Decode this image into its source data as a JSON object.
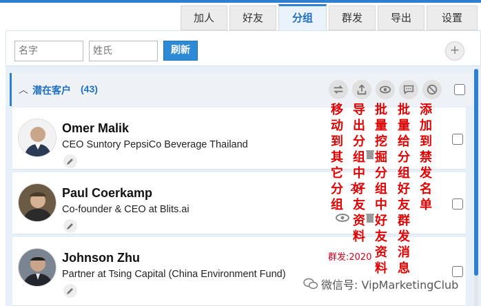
{
  "tabs": [
    {
      "label": "加人"
    },
    {
      "label": "好友"
    },
    {
      "label": "分组",
      "active": true
    },
    {
      "label": "群发"
    },
    {
      "label": "导出"
    },
    {
      "label": "设置"
    }
  ],
  "search": {
    "first_name_placeholder": "名字",
    "last_name_placeholder": "姓氏",
    "refresh_label": "刷新",
    "add_label": "+"
  },
  "group": {
    "name": "潜在客户",
    "count": "(43)",
    "actions": [
      "move-icon",
      "export-icon",
      "view-icon",
      "message-icon",
      "block-icon"
    ]
  },
  "contacts": [
    {
      "name": "Omer Malik",
      "title": "CEO Suntory PepsiCo Beverage Thailand"
    },
    {
      "name": "Paul Coerkamp",
      "title": "Co-founder & CEO at Blits.ai"
    },
    {
      "name": "Johnson Zhu",
      "title": "Partner at Tsing Capital (China Environment Fund)"
    }
  ],
  "send_status": {
    "row2": "20",
    "row3": "群发:2020"
  },
  "annotations": {
    "move": "移动到其它分组",
    "export": "导出分组中好友资料",
    "mine": "批量挖掘分组中好友资料",
    "message": "批量给分组好友群发消息",
    "block": "添加到禁发名单"
  },
  "watermark": "微信号: VipMarketingClub",
  "colors": {
    "accent": "#2f7fd0",
    "annotation": "#e00000",
    "status": "#d0021b"
  }
}
